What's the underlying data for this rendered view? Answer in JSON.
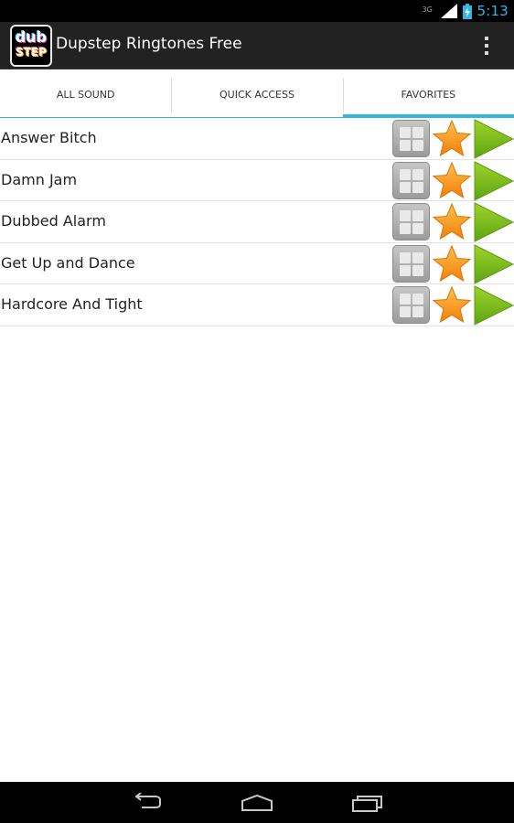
{
  "status_bar": {
    "network": "3G",
    "time": "5:13",
    "colors": {
      "accent": "#33b5e5"
    },
    "icons": [
      "signal-icon",
      "battery-charging-icon"
    ]
  },
  "action_bar": {
    "app_icon_line1": "dub",
    "app_icon_line2": "STEP",
    "title": "Dupstep Ringtones Free",
    "overflow_icon": "overflow-menu-icon"
  },
  "tabs": [
    {
      "label": "ALL SOUND",
      "selected": false
    },
    {
      "label": "QUICK ACCESS",
      "selected": false
    },
    {
      "label": "FAVORITES",
      "selected": true
    }
  ],
  "list": {
    "items": [
      {
        "label": "Answer Bitch"
      },
      {
        "label": "Damn Jam"
      },
      {
        "label": "Dubbed Alarm"
      },
      {
        "label": "Get Up and Dance"
      },
      {
        "label": "Hardcore And Tight"
      }
    ],
    "item_icons": [
      "grid-icon",
      "star-icon",
      "play-icon"
    ],
    "colors": {
      "star": "#f7941d",
      "play": "#7cbf1b",
      "grid": "#a9a9a9"
    }
  },
  "nav_bar": {
    "icons": [
      "back-icon",
      "home-icon",
      "recent-apps-icon"
    ]
  }
}
